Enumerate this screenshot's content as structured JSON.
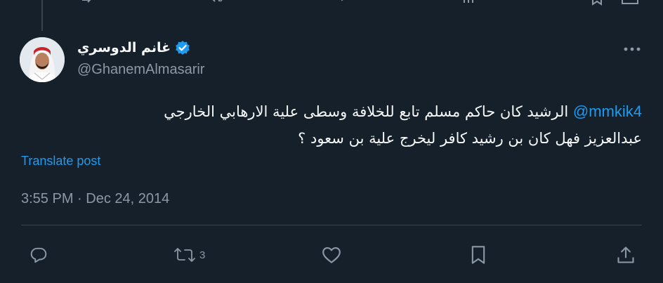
{
  "tweet": {
    "display_name": "غانم الدوسري",
    "handle": "@GhanemAlmasarir",
    "mention": "@mmkik4",
    "text_line1": "الرشيد كان حاكم مسلم تابع للخلافة وسطى علية الارهابي الخارجي",
    "text_line2": "عبدالعزيز فهل كان بن رشيد كافر ليخرج علية بن سعود ؟",
    "translate_label": "Translate post",
    "timestamp": "3:55 PM · Dec 24, 2014",
    "retweet_count": "3"
  },
  "icons": {
    "verified": "verified-badge-icon",
    "more": "more-horizontal-icon",
    "reply": "reply-icon",
    "retweet": "retweet-icon",
    "like": "heart-icon",
    "bookmark": "bookmark-icon",
    "share": "share-icon"
  },
  "colors": {
    "background": "#15202b",
    "text": "#f7f9f9",
    "secondary": "#8b98a5",
    "accent": "#1d9bf0",
    "divider": "#38444d"
  }
}
